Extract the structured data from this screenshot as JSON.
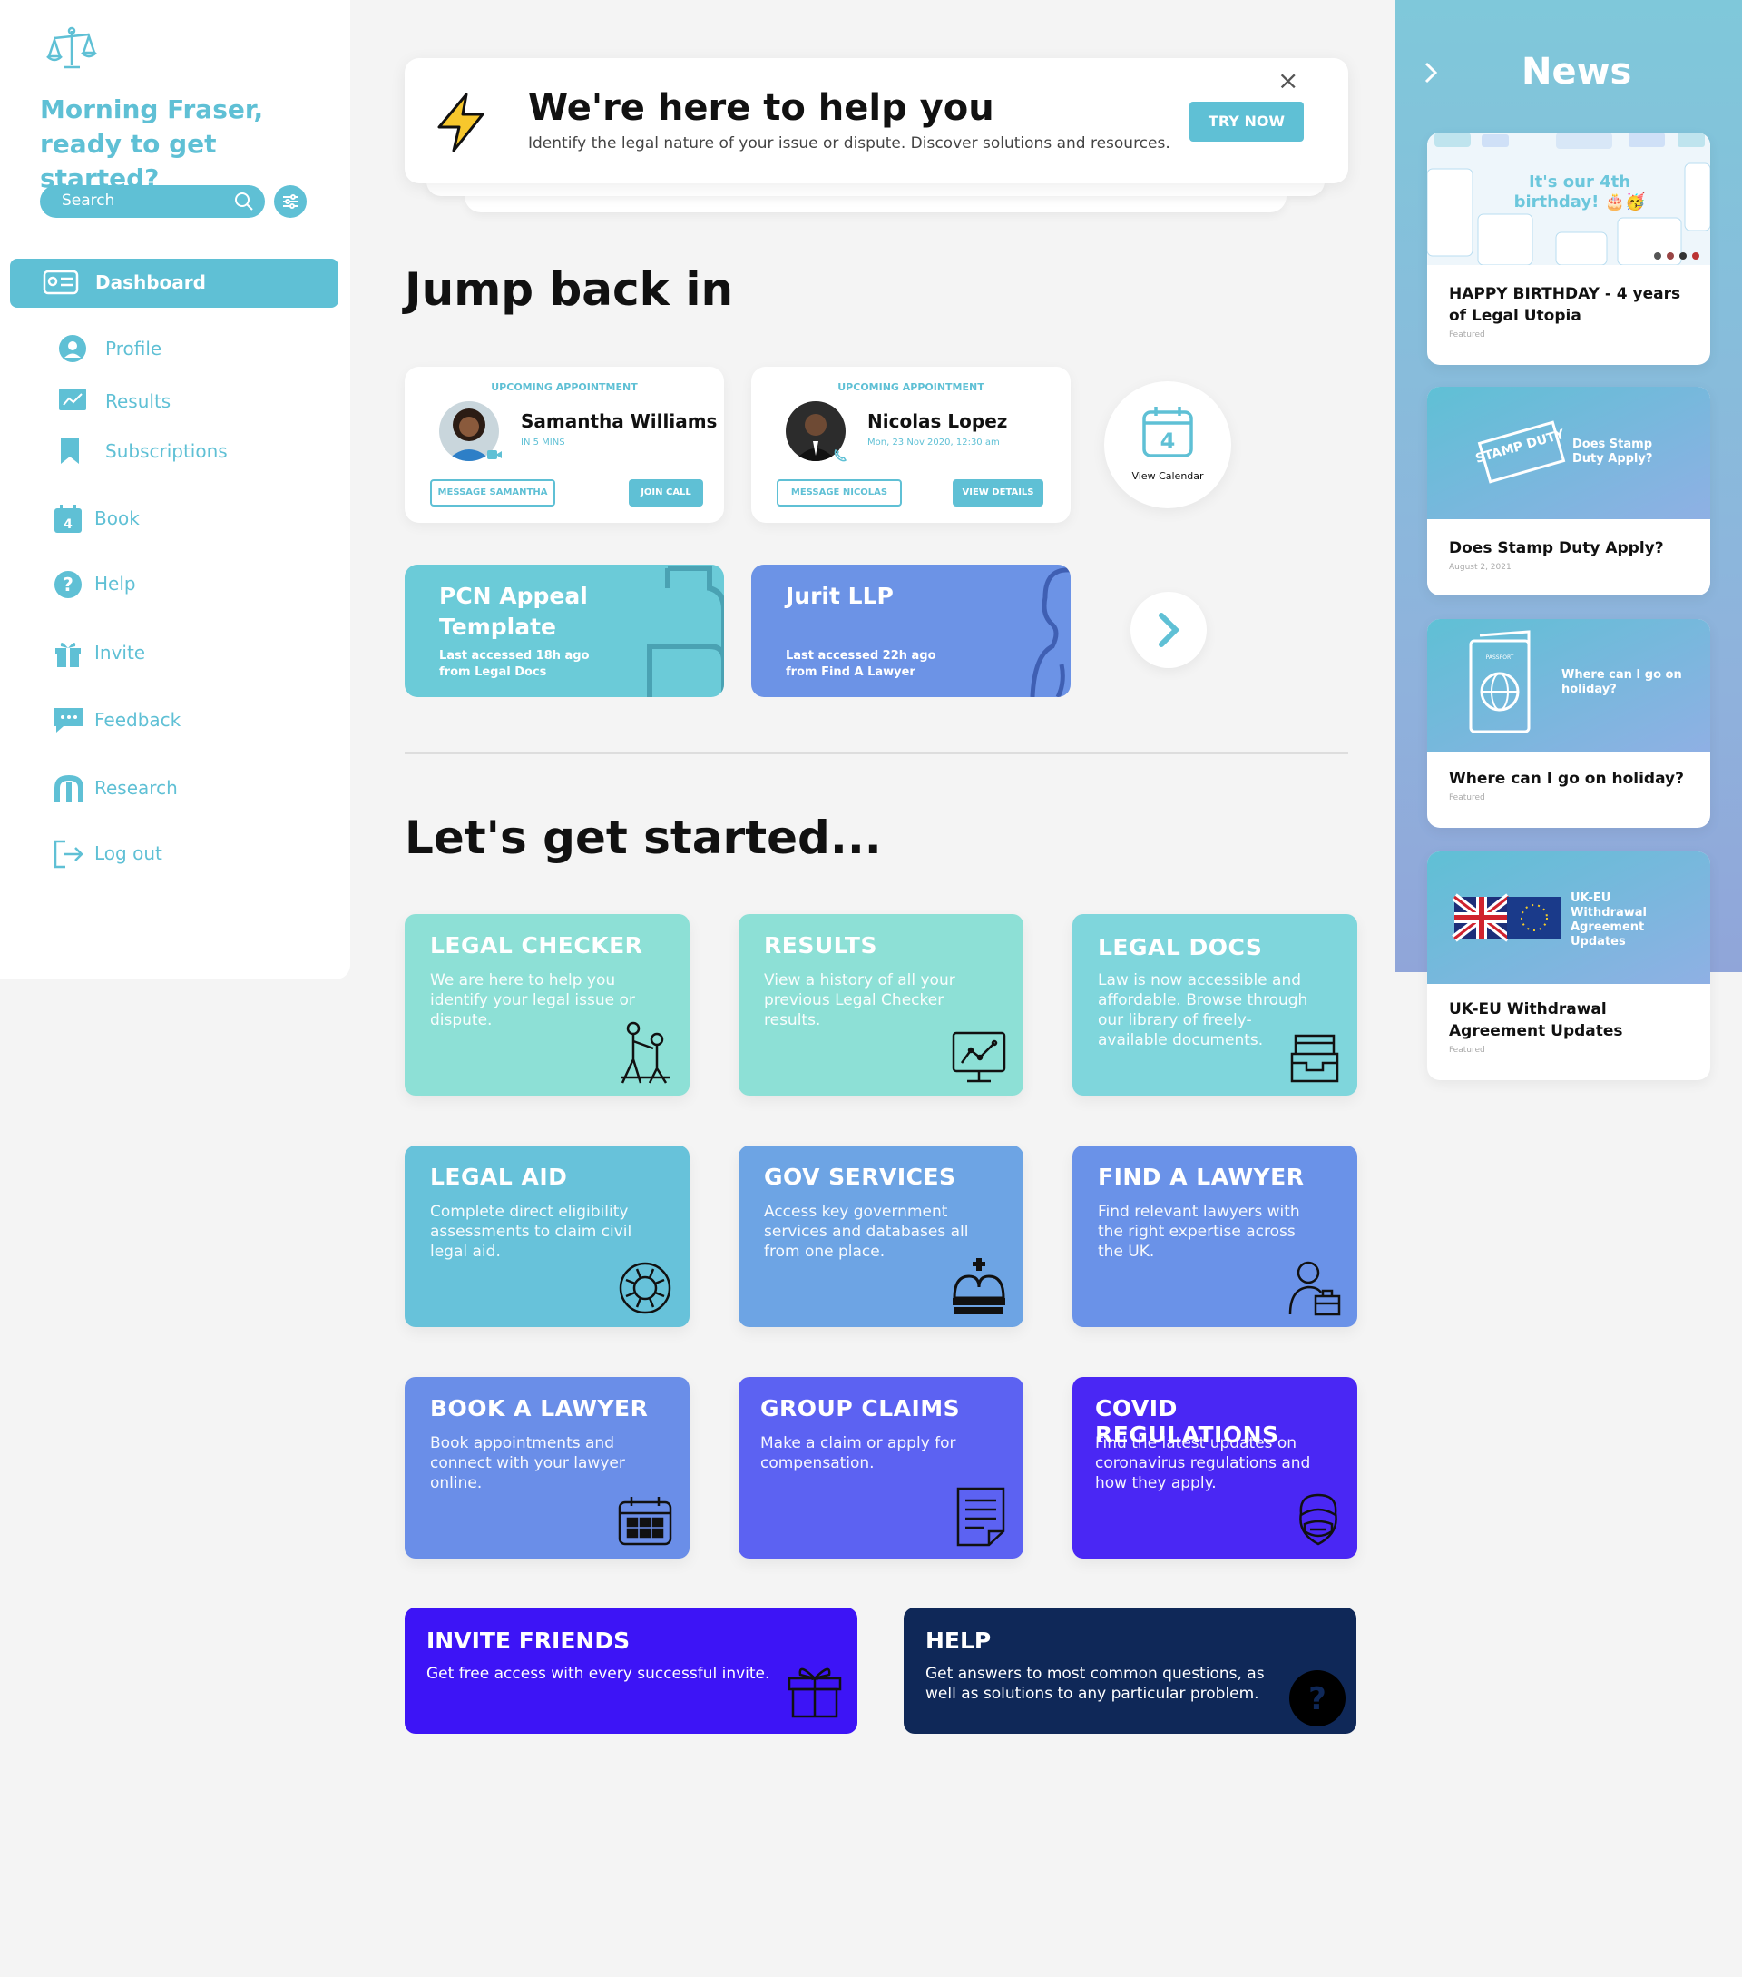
{
  "sidebar": {
    "greeting": "Morning Fraser, ready to get started?",
    "search_placeholder": "Search",
    "active_item": "Dashboard",
    "items": [
      {
        "label": "Profile"
      },
      {
        "label": "Results"
      },
      {
        "label": "Subscriptions"
      },
      {
        "label": "Book"
      },
      {
        "label": "Help"
      },
      {
        "label": "Invite"
      },
      {
        "label": "Feedback"
      },
      {
        "label": "Research"
      },
      {
        "label": "Log out"
      }
    ],
    "book_icon_day": "4"
  },
  "banner": {
    "title": "We're here to help you",
    "subtitle": "Identify the legal nature of your issue or dispute. Discover solutions and resources.",
    "cta": "TRY NOW",
    "close": "×"
  },
  "jump": {
    "heading": "Jump back in",
    "appointments": [
      {
        "tag": "UPCOMING APPOINTMENT",
        "name": "Samantha Williams",
        "detail": "IN 5 MINS",
        "secondary": "MESSAGE SAMANTHA",
        "primary": "JOIN CALL"
      },
      {
        "tag": "UPCOMING APPOINTMENT",
        "name": "Nicolas Lopez",
        "detail": "Mon, 23 Nov 2020, 12:30 am",
        "secondary": "MESSAGE NICOLAS",
        "primary": "VIEW DETAILS"
      }
    ],
    "calendar": {
      "day": "4",
      "label": "View Calendar"
    },
    "recent": [
      {
        "title": "PCN Appeal Template",
        "sub": "Last accessed 18h ago from Legal Docs"
      },
      {
        "title": "Jurit LLP",
        "sub": "Last accessed 22h ago from Find A Lawyer"
      }
    ]
  },
  "started": {
    "heading": "Let's get started...",
    "tiles": [
      {
        "title": "LEGAL CHECKER",
        "desc": "We are here to help you identify your legal issue or dispute.",
        "icon": "helping-hand-icon"
      },
      {
        "title": "RESULTS",
        "desc": "View a history of all your previous Legal Checker results.",
        "icon": "monitor-chart-icon"
      },
      {
        "title": "LEGAL DOCS",
        "desc": "Law is now accessible and affordable. Browse through our library of freely-available documents.",
        "icon": "document-tray-icon"
      },
      {
        "title": "LEGAL AID",
        "desc": "Complete direct eligibility assessments to claim civil legal aid.",
        "icon": "lifebuoy-icon"
      },
      {
        "title": "GOV SERVICES",
        "desc": "Access key government services and databases all from one place.",
        "icon": "crown-icon"
      },
      {
        "title": "FIND A LAWYER",
        "desc": "Find relevant lawyers with the right expertise across the UK.",
        "icon": "lawyer-briefcase-icon"
      },
      {
        "title": "BOOK A LAWYER",
        "desc": "Book appointments and connect with your lawyer online.",
        "icon": "calendar-icon"
      },
      {
        "title": "GROUP CLAIMS",
        "desc": "Make a claim or apply for compensation.",
        "icon": "document-icon"
      },
      {
        "title": "COVID REGULATIONS",
        "desc": "Find the latest updates on coronavirus regulations and how they apply.",
        "icon": "mask-face-icon"
      }
    ],
    "wide": [
      {
        "title": "INVITE FRIENDS",
        "desc": "Get free access with every successful invite.",
        "icon": "gift-icon"
      },
      {
        "title": "HELP",
        "desc": "Get answers to most common questions, as well as solutions to any particular problem.",
        "icon": "question-icon"
      }
    ]
  },
  "news": {
    "title": "News",
    "cards": [
      {
        "headline": "HAPPY BIRTHDAY - 4 years of Legal Utopia",
        "meta": "Featured",
        "overlay": "It's our 4th birthday! 🎂🥳"
      },
      {
        "headline": "Does Stamp Duty Apply?",
        "meta": "August 2, 2021",
        "overlay": "Does Stamp Duty Apply?",
        "stamp": "STAMP DUTY"
      },
      {
        "headline": "Where can I go on holiday?",
        "meta": "Featured",
        "overlay": "Where can I go on holiday?",
        "passport": "PASSPORT"
      },
      {
        "headline": "UK-EU Withdrawal Agreement Updates",
        "meta": "Featured",
        "overlay": "UK-EU Withdrawal Agreement Updates"
      }
    ]
  },
  "colors": {
    "teal": "#5fc0d5",
    "mint": "#8ee0d6",
    "blue": "#6a94e8",
    "violet": "#4d2af7",
    "navy": "#10285a"
  }
}
